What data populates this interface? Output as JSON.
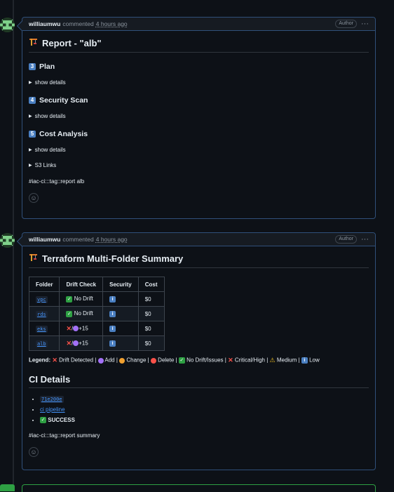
{
  "comments": [
    {
      "author": "williaumwu",
      "action": "commented",
      "time": "4 hours ago",
      "badge": "Author",
      "title": "Report - \"alb\"",
      "title_icon": "construction-crane-icon",
      "sections": [
        {
          "num": "3",
          "heading": "Plan",
          "details": "show details"
        },
        {
          "num": "4",
          "heading": "Security Scan",
          "details": "show details"
        },
        {
          "num": "5",
          "heading": "Cost Analysis",
          "details": "show details"
        }
      ],
      "s3_links": "S3 Links",
      "tag": "#iac-ci:::tag::report alb"
    },
    {
      "author": "williaumwu",
      "action": "commented",
      "time": "4 hours ago",
      "badge": "Author",
      "title": "Terraform Multi-Folder Summary",
      "title_icon": "construction-crane-icon",
      "table": {
        "headers": [
          "Folder",
          "Drift Check",
          "Security",
          "Cost"
        ],
        "rows": [
          {
            "folder": "vpc",
            "drift_icon": "check-icon",
            "drift_text": "No Drift",
            "security": "info-icon",
            "cost": "$0"
          },
          {
            "folder": "rds",
            "drift_icon": "check-icon",
            "drift_text": "No Drift",
            "security": "info-icon",
            "cost": "$0"
          },
          {
            "folder": "eks",
            "drift_icon": "x-add-icon",
            "drift_text": "+15",
            "security": "info-icon",
            "cost": "$0"
          },
          {
            "folder": "alb",
            "drift_icon": "x-add-icon",
            "drift_text": "+15",
            "security": "info-icon",
            "cost": "$0"
          }
        ]
      },
      "legend": {
        "label": "Legend:",
        "items": [
          "Drift Detected |",
          "Add |",
          "Change |",
          "Delete |",
          "No Drift/Issues |",
          "Critical/High |",
          "Medium |",
          "Low"
        ]
      },
      "ci_heading": "CI Details",
      "ci_items": {
        "sha": "71e200e",
        "pipeline": "ci pipeline",
        "status": "SUCCESS"
      },
      "tag": "#iac-ci:::tag::report summary"
    }
  ],
  "colors": {
    "background": "#0d1117",
    "border_accent": "#30507a",
    "link": "#4493f8",
    "success": "#2ea043",
    "danger": "#f85149",
    "purple": "#a371f7",
    "orange": "#f0a030"
  }
}
